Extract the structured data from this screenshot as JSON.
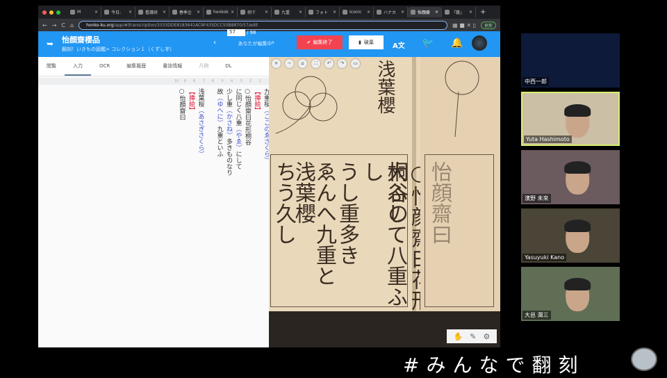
{
  "browser": {
    "tabs": [
      "M",
      "今日:",
      "看護研",
      "春季企",
      "honkok",
      "例で",
      "九重",
      "フォト",
      "Iconic",
      "ハナカ",
      "怡顔齋",
      "『籠』"
    ],
    "url_host": "honko-ku.org",
    "url_path": "/app/#/transcription/3333DDE8183641AC9F435DCC50B8870/57/edit",
    "update_label": "更新"
  },
  "header": {
    "title": "怡顔齋櫻品",
    "breadcrumb": "翻刻！いきもの図鑑> コレクション１（くずし字）",
    "page_current": "57",
    "page_total": "/ 98",
    "editing_status": "あなたが編集中",
    "finish_label": "編集終了",
    "discard_label": "破棄",
    "translate_icon": "A文"
  },
  "tabs": [
    "閲覧",
    "入力",
    "OCR",
    "編集履歴",
    "書誌情報",
    "凡例",
    "DL"
  ],
  "column_numbers": [
    "10",
    "9",
    "8",
    "7",
    "6",
    "5",
    "4",
    "3",
    "2",
    "1"
  ],
  "columns": [
    [
      {
        "t": "九重桜"
      },
      {
        "t": "（ここのゑざくら）",
        "c": "r"
      }
    ],
    [
      {
        "t": "【挿絵】",
        "c": "red"
      }
    ],
    [
      {
        "t": "○怡顔齋曰花形桐谷"
      }
    ],
    [
      {
        "t": "に同じく八重"
      },
      {
        "t": "（やゑ）",
        "c": "r"
      },
      {
        "t": "にして"
      }
    ],
    [
      {
        "t": "少し重"
      },
      {
        "t": "（かさね）",
        "c": "r"
      },
      {
        "t": "多きものなり"
      }
    ],
    [
      {
        "t": "故"
      },
      {
        "t": "（ゆへに）",
        "c": "r"
      },
      {
        "t": "九重といふ"
      }
    ],
    [
      {
        "t": ""
      }
    ],
    [
      {
        "t": "浅葉桜"
      },
      {
        "t": "（あさぎさくら）",
        "c": "r"
      }
    ],
    [
      {
        "t": "【挿絵】",
        "c": "red"
      }
    ],
    [
      {
        "t": "○怡顔齋曰"
      }
    ]
  ],
  "image": {
    "heading1": "浅葉櫻",
    "col1": "○怡顔齋曰花形桐谷の",
    "col2": "大ふして八重ふし",
    "col3": "うし重多き",
    "col4": "ゑんへ九重と",
    "col5": "浅葉櫻",
    "col6": "ちう久し",
    "page2_col": "怡顔齋曰"
  },
  "video": [
    {
      "name": "中西一郎",
      "bg": "#0d1a3a"
    },
    {
      "name": "Yuta Hashimoto",
      "bg": "#cbbfa5",
      "active": true
    },
    {
      "name": "濱野 未來",
      "bg": "#6b5a5e"
    },
    {
      "name": "Yasuyuki Kano",
      "bg": "#4a4536"
    },
    {
      "name": "大邑 潤三",
      "bg": "#5f6e55"
    }
  ],
  "hashtag": "#みんなで翻刻",
  "fab_label": "+"
}
